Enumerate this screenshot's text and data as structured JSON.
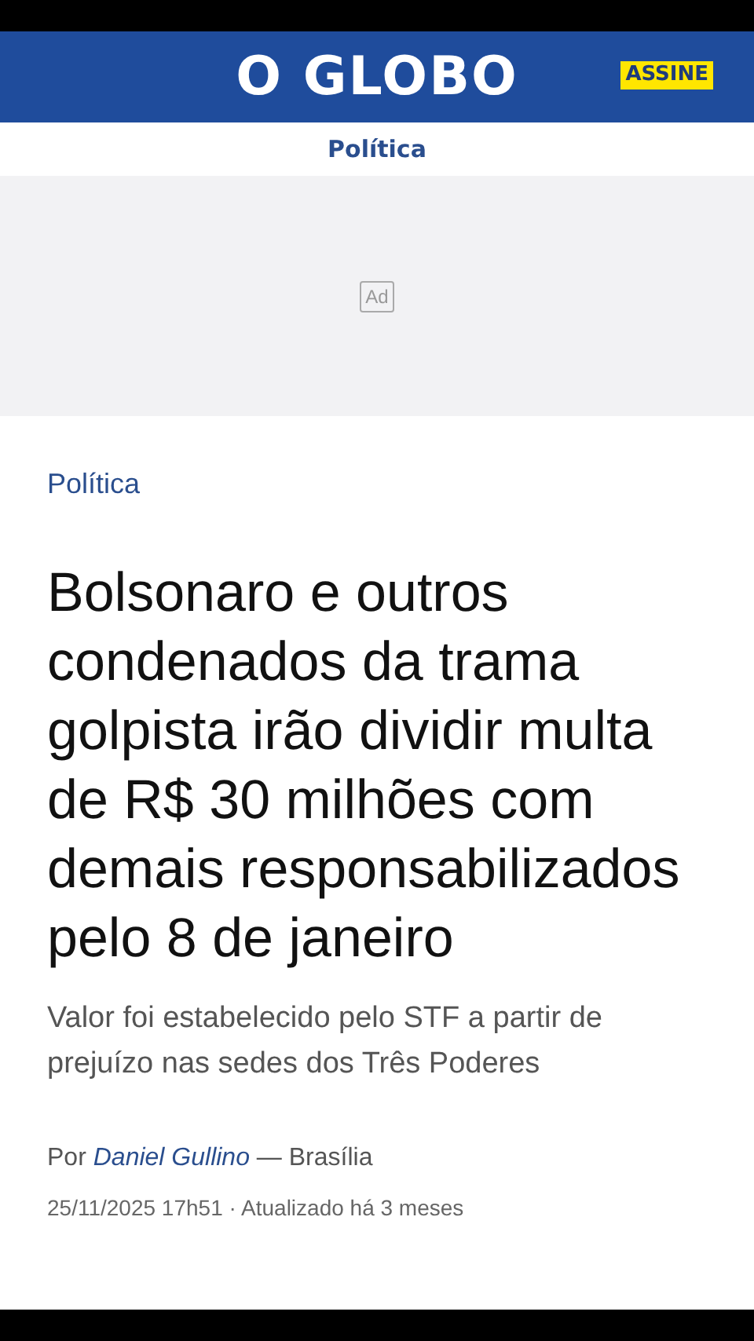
{
  "header": {
    "logo": "O GLOBO",
    "subscribe_button": "ASSINE"
  },
  "section_nav": {
    "label": "Política"
  },
  "ad": {
    "label": "Ad"
  },
  "article": {
    "section": "Política",
    "headline": "Bolsonaro e outros condenados da trama golpista irão dividir multa de R$ 30 milhões com demais responsabilizados pelo 8 de janeiro",
    "subtitle": "Valor foi estabelecido pelo STF a partir de prejuízo nas sedes dos Três Poderes",
    "byline": {
      "prefix": "Por",
      "author": "Daniel Gullino",
      "suffix": "— Brasília"
    },
    "timestamp": "25/11/2025 17h51 · Atualizado há 3 meses"
  }
}
